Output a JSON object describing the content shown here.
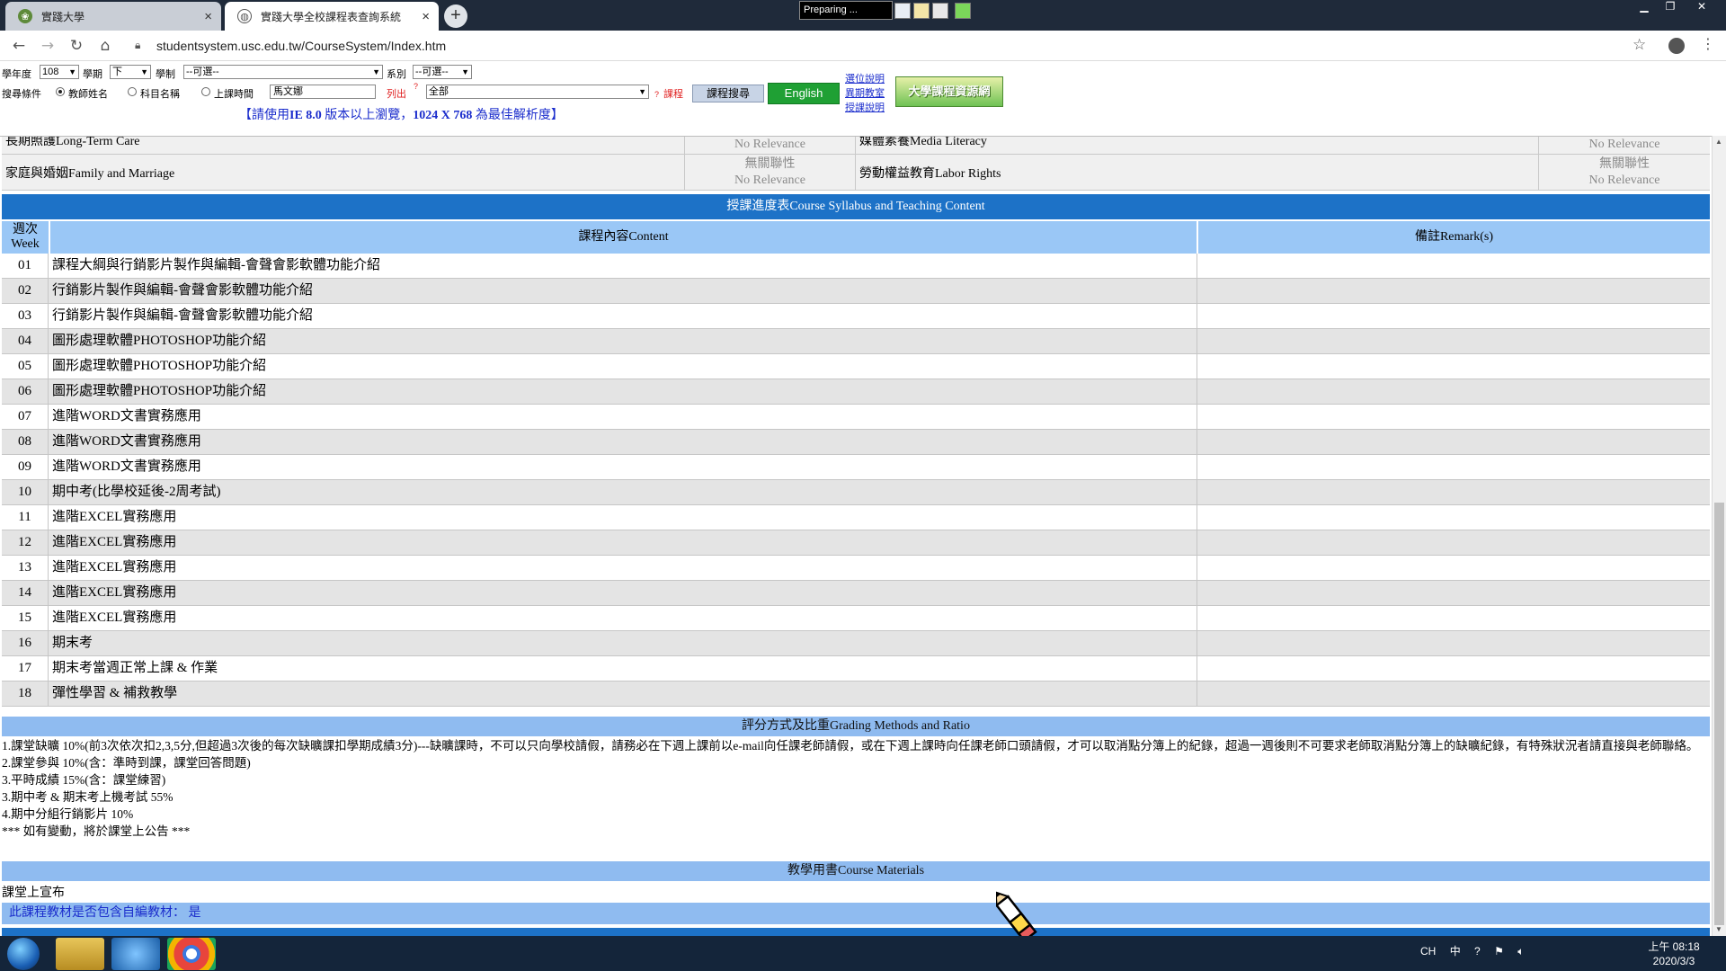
{
  "browser": {
    "tabs": [
      {
        "title": "實踐大學"
      },
      {
        "title": "實踐大學全校課程表查詢系統"
      }
    ],
    "preparing_label": "Preparing ...",
    "url": "studentsystem.usc.edu.tw/CourseSystem/Index.htm"
  },
  "search_form": {
    "year_label": "學年度",
    "year_value": "108",
    "semester_label": "學期",
    "semester_value": "下",
    "system_label": "學制",
    "system_value": "--可選--",
    "dept_label": "系別",
    "dept_value": "--可選--",
    "criteria_label": "搜尋條件",
    "radio_teacher": "教師姓名",
    "radio_course": "科目名稱",
    "radio_time": "上課時間",
    "teacher_input_value": "馬文娜",
    "list_label": "列出",
    "scope_value": "全部",
    "course_label": "課程",
    "search_button": "課程搜尋",
    "english_button": "English",
    "links": [
      "選位說明",
      "異期教室",
      "授課說明"
    ],
    "banner_text": "大學課程資源網",
    "ie_note_prefix": "【請使用",
    "ie_note_ie": "IE 8.0",
    "ie_note_mid": "版本以上瀏覽，",
    "ie_note_res": "1024 X 768",
    "ie_note_suffix": "為最佳解析度】"
  },
  "relevance_rows": [
    {
      "left_name": "長期照護Long-Term Care",
      "left_zh": "",
      "left_en": "No Relevance",
      "right_name": "媒體素養Media Literacy",
      "right_zh": "",
      "right_en": "No Relevance"
    },
    {
      "left_name": "家庭與婚姻Family and Marriage",
      "left_zh": "無關聯性",
      "left_en": "No Relevance",
      "right_name": "勞動權益教育Labor Rights",
      "right_zh": "無關聯性",
      "right_en": "No Relevance"
    }
  ],
  "syllabus": {
    "title": "授課進度表Course Syllabus and Teaching Content",
    "col_week_zh": "週次",
    "col_week_en": "Week",
    "col_content": "課程內容Content",
    "col_remark": "備註Remark(s)",
    "weeks": [
      {
        "week": "01",
        "content": "課程大綱與行銷影片製作與編輯-會聲會影軟體功能介紹",
        "remark": ""
      },
      {
        "week": "02",
        "content": "行銷影片製作與編輯-會聲會影軟體功能介紹",
        "remark": ""
      },
      {
        "week": "03",
        "content": "行銷影片製作與編輯-會聲會影軟體功能介紹",
        "remark": ""
      },
      {
        "week": "04",
        "content": "圖形處理軟體PHOTOSHOP功能介紹",
        "remark": ""
      },
      {
        "week": "05",
        "content": "圖形處理軟體PHOTOSHOP功能介紹",
        "remark": ""
      },
      {
        "week": "06",
        "content": "圖形處理軟體PHOTOSHOP功能介紹",
        "remark": ""
      },
      {
        "week": "07",
        "content": "進階WORD文書實務應用",
        "remark": ""
      },
      {
        "week": "08",
        "content": "進階WORD文書實務應用",
        "remark": ""
      },
      {
        "week": "09",
        "content": "進階WORD文書實務應用",
        "remark": ""
      },
      {
        "week": "10",
        "content": "期中考(比學校延後-2周考試)",
        "remark": ""
      },
      {
        "week": "11",
        "content": "進階EXCEL實務應用",
        "remark": ""
      },
      {
        "week": "12",
        "content": "進階EXCEL實務應用",
        "remark": ""
      },
      {
        "week": "13",
        "content": "進階EXCEL實務應用",
        "remark": ""
      },
      {
        "week": "14",
        "content": "進階EXCEL實務應用",
        "remark": ""
      },
      {
        "week": "15",
        "content": "進階EXCEL實務應用",
        "remark": ""
      },
      {
        "week": "16",
        "content": "期末考",
        "remark": ""
      },
      {
        "week": "17",
        "content": "期末考當週正常上課 & 作業",
        "remark": ""
      },
      {
        "week": "18",
        "content": "彈性學習 & 補救教學",
        "remark": ""
      }
    ]
  },
  "grading": {
    "title": "評分方式及比重Grading Methods and Ratio",
    "lines": [
      "1.課堂缺曠 10%(前3次依次扣2,3,5分,但超過3次後的每次缺曠課扣學期成績3分)---缺曠課時，不可以只向學校請假，請務必在下週上課前以e-mail向任課老師請假，或在下週上課時向任課老師口頭請假，才可以取消點分簿上的紀錄，超過一週後則不可要求老師取消點分簿上的缺曠紀錄，有特殊狀況者請直接與老師聯絡。",
      "2.課堂參與 10%(含：準時到課，課堂回答問題)",
      "3.平時成績 15%(含：課堂練習)",
      "3.期中考 & 期末考上機考試 55%",
      "4.期中分組行銷影片 10%",
      "*** 如有變動，將於課堂上公告 ***"
    ]
  },
  "materials": {
    "title": "教學用書Course Materials",
    "text": "課堂上宣布",
    "self_made_label": "此課程教材是否包含自編教材：",
    "self_made_value": "是"
  },
  "taskbar": {
    "tray_lang": "CH",
    "tray_ime": "中",
    "clock_time": "上午 08:18",
    "clock_date": "2020/3/3"
  }
}
